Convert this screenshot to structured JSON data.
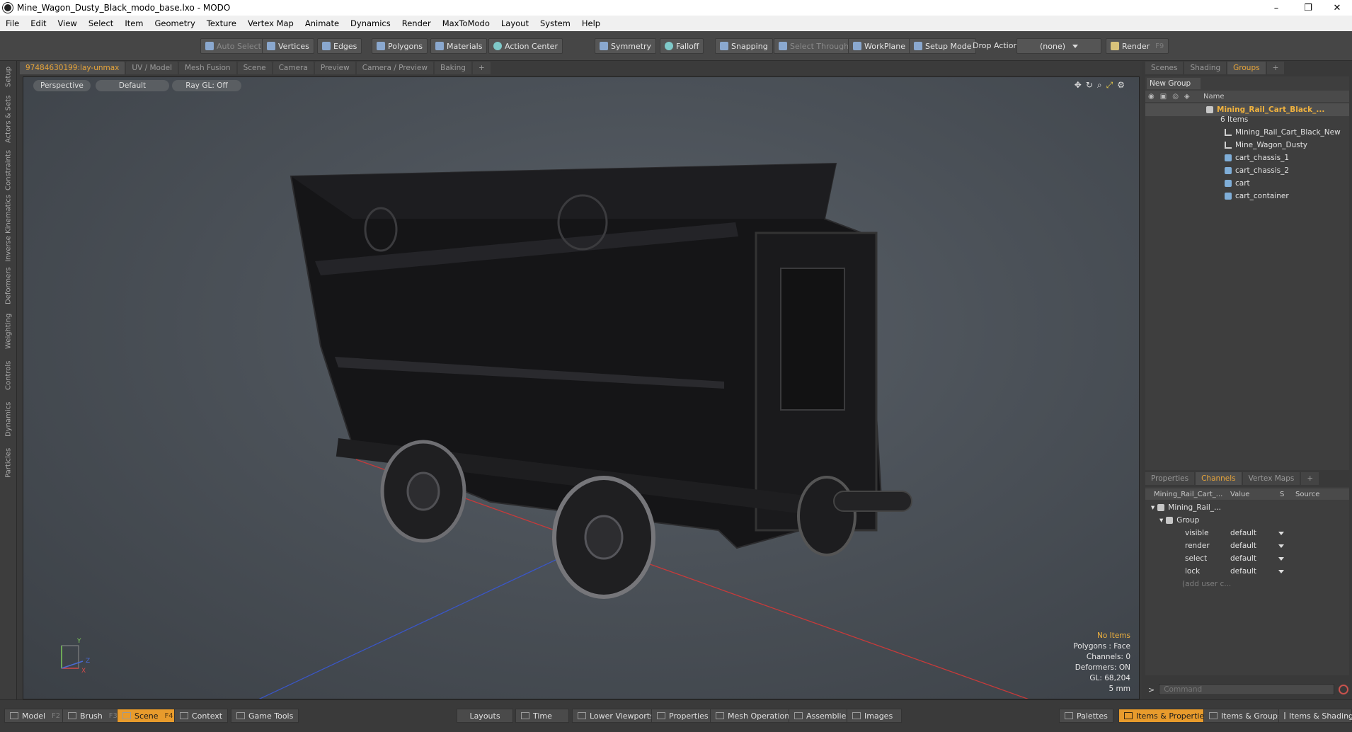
{
  "window": {
    "title": "Mine_Wagon_Dusty_Black_modo_base.lxo - MODO",
    "controls": [
      "–",
      "❐",
      "✕"
    ]
  },
  "menu": [
    "File",
    "Edit",
    "View",
    "Select",
    "Item",
    "Geometry",
    "Texture",
    "Vertex Map",
    "Animate",
    "Dynamics",
    "Render",
    "MaxToModo",
    "Layout",
    "System",
    "Help"
  ],
  "toolbar": {
    "auto_select": "Auto Select",
    "vertices": "Vertices",
    "edges": "Edges",
    "polygons": "Polygons",
    "materials": "Materials",
    "action_center": "Action Center",
    "symmetry": "Symmetry",
    "falloff": "Falloff",
    "snapping": "Snapping",
    "select_through": "Select Through",
    "workplane": "WorkPlane",
    "setup_mode": "Setup Mode",
    "drop_action": "Drop Action",
    "drop_value": "(none)",
    "render": "Render",
    "render_key": "F9"
  },
  "left_tabs": [
    "Setup",
    "Actors & Sets",
    "Constraints",
    "Inverse Kinematics",
    "Deformers",
    "Weighting",
    "Controls",
    "Dynamics",
    "Particles"
  ],
  "viewport_tabs": [
    "97484630199:lay-unmax",
    "UV / Model",
    "Mesh Fusion",
    "Scene",
    "Camera",
    "Preview",
    "Camera / Preview",
    "Baking",
    "+"
  ],
  "viewport": {
    "view": "Perspective",
    "shading": "Default",
    "raygl": "Ray GL: Off",
    "info": {
      "items": "No Items",
      "polygons": "Polygons : Face",
      "channels": "Channels: 0",
      "deformers": "Deformers: ON",
      "gl": "GL: 68,204",
      "scale": "5 mm"
    },
    "axes": {
      "x": "X",
      "y": "Y",
      "z": "Z"
    }
  },
  "scene_panel": {
    "tabs": [
      "Scenes",
      "Shading",
      "Groups",
      "+"
    ],
    "new_group": "New Group",
    "name_col": "Name",
    "group_name": "Mining_Rail_Cart_Black_...",
    "count": "6 Items",
    "items": [
      {
        "name": "Mining_Rail_Cart_Black_New",
        "icon": "locator-icon"
      },
      {
        "name": "Mine_Wagon_Dusty",
        "icon": "locator-icon"
      },
      {
        "name": "cart_chassis_1",
        "icon": "mesh-icon"
      },
      {
        "name": "cart_chassis_2",
        "icon": "mesh-icon"
      },
      {
        "name": "cart",
        "icon": "mesh-icon"
      },
      {
        "name": "cart_container",
        "icon": "mesh-icon"
      }
    ]
  },
  "props_panel": {
    "tabs": [
      "Properties",
      "Channels",
      "Vertex Maps",
      "+"
    ],
    "cols": {
      "name": "Mining_Rail_Cart_...",
      "value": "Value",
      "s": "S",
      "source": "Source"
    },
    "root": "Mining_Rail_...",
    "group": "Group",
    "channels": [
      {
        "name": "visible",
        "value": "default"
      },
      {
        "name": "render",
        "value": "default"
      },
      {
        "name": "select",
        "value": "default"
      },
      {
        "name": "lock",
        "value": "default"
      }
    ],
    "add_user": "(add user c..."
  },
  "command": {
    "prompt": ">",
    "placeholder": "Command"
  },
  "bottom": {
    "model": "Model",
    "model_key": "F2",
    "brush": "Brush",
    "brush_key": "F3",
    "scene": "Scene",
    "scene_key": "F4",
    "context": "Context",
    "game_tools": "Game Tools",
    "layouts": "Layouts",
    "time": "Time",
    "lower_viewports": "Lower Viewports",
    "properties": "Properties",
    "mesh_operations": "Mesh Operations",
    "assemblies": "Assemblies",
    "images": "Images",
    "palettes": "Palettes",
    "items_properties": "Items & Properties",
    "items_groups": "Items & Groups",
    "items_shading": "Items & Shading"
  },
  "colors": {
    "accent": "#e89b2c",
    "selected_text": "#f0b23e"
  }
}
